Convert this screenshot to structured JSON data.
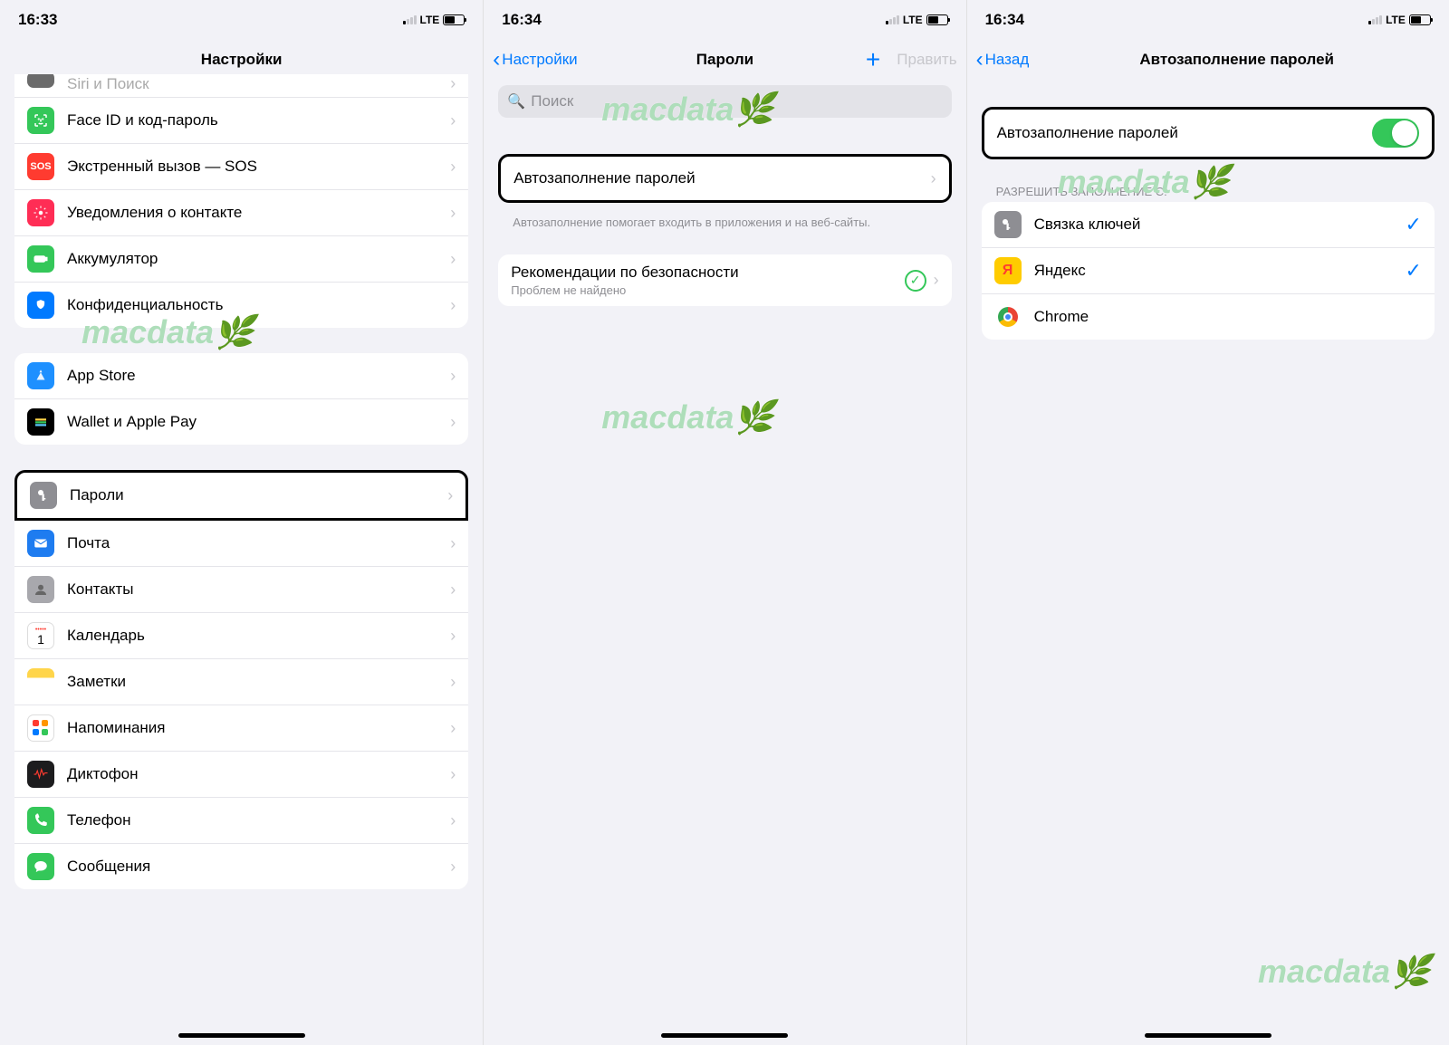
{
  "watermark": "macdata",
  "screen1": {
    "time": "16:33",
    "nav_title": "Настройки",
    "lte": "LTE",
    "groups": {
      "g1": [
        {
          "icon": "siri",
          "label": "Siri и Поиск"
        },
        {
          "icon": "faceid",
          "label": "Face ID и код-пароль"
        },
        {
          "icon": "sos",
          "label": "Экстренный вызов — SOS",
          "icon_text": "SOS"
        },
        {
          "icon": "contact",
          "label": "Уведомления о контакте"
        },
        {
          "icon": "battery",
          "label": "Аккумулятор"
        },
        {
          "icon": "privacy",
          "label": "Конфиденциальность"
        }
      ],
      "g2": [
        {
          "icon": "appstore",
          "label": "App Store"
        },
        {
          "icon": "wallet",
          "label": "Wallet и Apple Pay"
        }
      ],
      "g3": [
        {
          "icon": "passwords",
          "label": "Пароли",
          "highlight": true
        },
        {
          "icon": "mail",
          "label": "Почта"
        },
        {
          "icon": "contacts",
          "label": "Контакты"
        },
        {
          "icon": "calendar",
          "label": "Календарь"
        },
        {
          "icon": "notes",
          "label": "Заметки"
        },
        {
          "icon": "reminders",
          "label": "Напоминания"
        },
        {
          "icon": "voice",
          "label": "Диктофон"
        },
        {
          "icon": "phone",
          "label": "Телефон"
        },
        {
          "icon": "messages",
          "label": "Сообщения"
        }
      ]
    }
  },
  "screen2": {
    "time": "16:34",
    "lte": "LTE",
    "nav_back": "Настройки",
    "nav_title": "Пароли",
    "nav_edit": "Править",
    "search_placeholder": "Поиск",
    "autofill_label": "Автозаполнение паролей",
    "autofill_footer": "Автозаполнение помогает входить в приложения и на веб-сайты.",
    "recommend_label": "Рекомендации по безопасности",
    "recommend_sub": "Проблем не найдено"
  },
  "screen3": {
    "time": "16:34",
    "lte": "LTE",
    "nav_back": "Назад",
    "nav_title": "Автозаполнение паролей",
    "toggle_label": "Автозаполнение паролей",
    "allow_header": "РАЗРЕШИТЬ ЗАПОЛНЕНИЕ С:",
    "providers": [
      {
        "icon": "keychain",
        "label": "Связка ключей",
        "checked": true
      },
      {
        "icon": "yandex",
        "label": "Яндекс",
        "checked": true,
        "icon_text": "Я"
      },
      {
        "icon": "chrome",
        "label": "Chrome",
        "checked": false
      }
    ]
  }
}
